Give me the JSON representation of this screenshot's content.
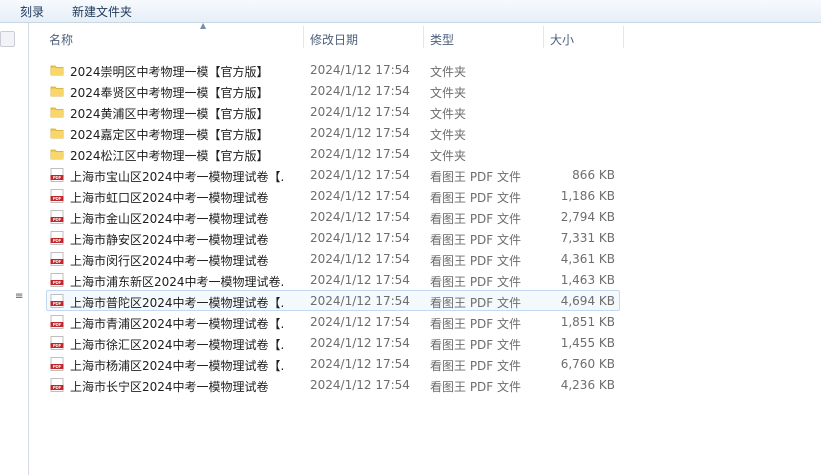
{
  "toolbar": {
    "burn": "刻录",
    "new_folder": "新建文件夹"
  },
  "columns": {
    "name": "名称",
    "date": "修改日期",
    "type": "类型",
    "size": "大小"
  },
  "files": [
    {
      "icon": "folder",
      "name": "2024崇明区中考物理一模【官方版】",
      "date": "2024/1/12 17:54",
      "type": "文件夹",
      "size": ""
    },
    {
      "icon": "folder",
      "name": "2024奉贤区中考物理一模【官方版】",
      "date": "2024/1/12 17:54",
      "type": "文件夹",
      "size": ""
    },
    {
      "icon": "folder",
      "name": "2024黄浦区中考物理一模【官方版】",
      "date": "2024/1/12 17:54",
      "type": "文件夹",
      "size": ""
    },
    {
      "icon": "folder",
      "name": "2024嘉定区中考物理一模【官方版】",
      "date": "2024/1/12 17:54",
      "type": "文件夹",
      "size": ""
    },
    {
      "icon": "folder",
      "name": "2024松江区中考物理一模【官方版】",
      "date": "2024/1/12 17:54",
      "type": "文件夹",
      "size": ""
    },
    {
      "icon": "pdf",
      "name": "上海市宝山区2024中考一模物理试卷【...",
      "date": "2024/1/12 17:54",
      "type": "看图王 PDF 文件",
      "size": "866 KB"
    },
    {
      "icon": "pdf",
      "name": "上海市虹口区2024中考一模物理试卷",
      "date": "2024/1/12 17:54",
      "type": "看图王 PDF 文件",
      "size": "1,186 KB"
    },
    {
      "icon": "pdf",
      "name": "上海市金山区2024中考一模物理试卷",
      "date": "2024/1/12 17:54",
      "type": "看图王 PDF 文件",
      "size": "2,794 KB"
    },
    {
      "icon": "pdf",
      "name": "上海市静安区2024中考一模物理试卷",
      "date": "2024/1/12 17:54",
      "type": "看图王 PDF 文件",
      "size": "7,331 KB"
    },
    {
      "icon": "pdf",
      "name": "上海市闵行区2024中考一模物理试卷",
      "date": "2024/1/12 17:54",
      "type": "看图王 PDF 文件",
      "size": "4,361 KB"
    },
    {
      "icon": "pdf",
      "name": "上海市浦东新区2024中考一模物理试卷...",
      "date": "2024/1/12 17:54",
      "type": "看图王 PDF 文件",
      "size": "1,463 KB"
    },
    {
      "icon": "pdf",
      "name": "上海市普陀区2024中考一模物理试卷【...",
      "date": "2024/1/12 17:54",
      "type": "看图王 PDF 文件",
      "size": "4,694 KB",
      "selected": true
    },
    {
      "icon": "pdf",
      "name": "上海市青浦区2024中考一模物理试卷【...",
      "date": "2024/1/12 17:54",
      "type": "看图王 PDF 文件",
      "size": "1,851 KB"
    },
    {
      "icon": "pdf",
      "name": "上海市徐汇区2024中考一模物理试卷【...",
      "date": "2024/1/12 17:54",
      "type": "看图王 PDF 文件",
      "size": "1,455 KB"
    },
    {
      "icon": "pdf",
      "name": "上海市杨浦区2024中考一模物理试卷【...",
      "date": "2024/1/12 17:54",
      "type": "看图王 PDF 文件",
      "size": "6,760 KB"
    },
    {
      "icon": "pdf",
      "name": "上海市长宁区2024中考一模物理试卷",
      "date": "2024/1/12 17:54",
      "type": "看图王 PDF 文件",
      "size": "4,236 KB"
    }
  ]
}
